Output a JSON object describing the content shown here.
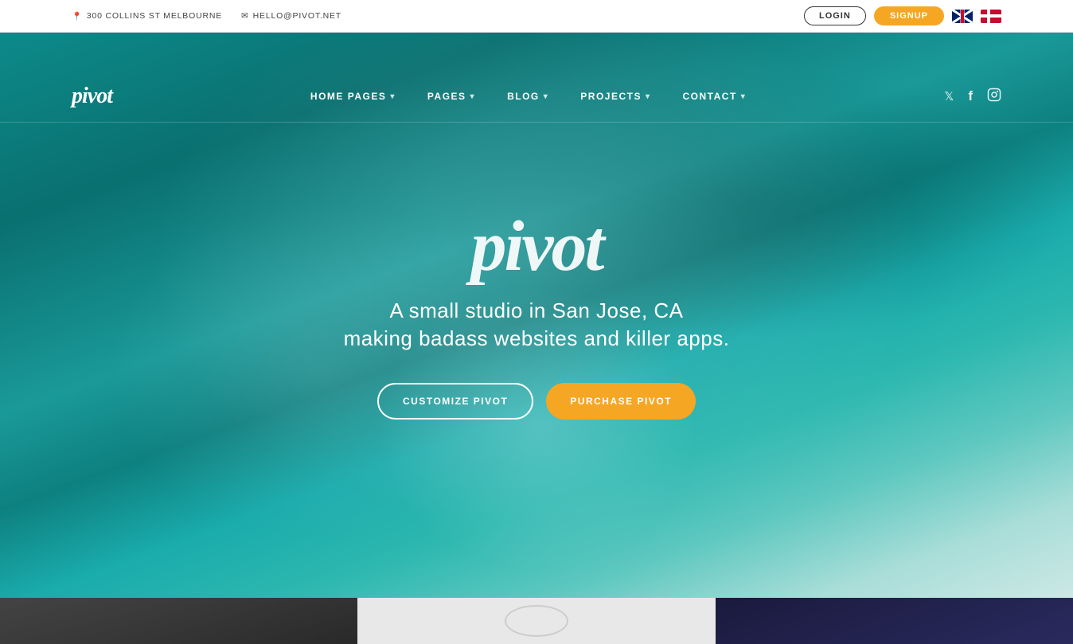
{
  "topbar": {
    "address_icon": "location-pin",
    "address": "300 COLLINS ST MELBOURNE",
    "email_icon": "envelope",
    "email": "HELLO@PIVOT.NET",
    "btn_login": "LOGIN",
    "btn_signup": "SIGNUP"
  },
  "navbar": {
    "logo": "pivot",
    "menu": [
      {
        "label": "HOME PAGES",
        "has_dropdown": true
      },
      {
        "label": "PAGES",
        "has_dropdown": true
      },
      {
        "label": "BLOG",
        "has_dropdown": true
      },
      {
        "label": "PROJECTS",
        "has_dropdown": true
      },
      {
        "label": "CONTACT",
        "has_dropdown": true
      }
    ],
    "social": [
      {
        "name": "twitter",
        "symbol": "𝕏"
      },
      {
        "name": "facebook",
        "symbol": "f"
      },
      {
        "name": "instagram",
        "symbol": "⌷"
      }
    ]
  },
  "hero": {
    "logo": "pivot",
    "tagline_line1": "A small studio in San Jose, CA",
    "tagline_line2": "making badass websites and killer apps.",
    "btn_customize": "CUSTOMIZE PIVOT",
    "btn_purchase": "PURCHASE PIVOT"
  },
  "colors": {
    "orange": "#f5a623",
    "teal_dark": "#0a7070",
    "teal_mid": "#1a9999"
  }
}
